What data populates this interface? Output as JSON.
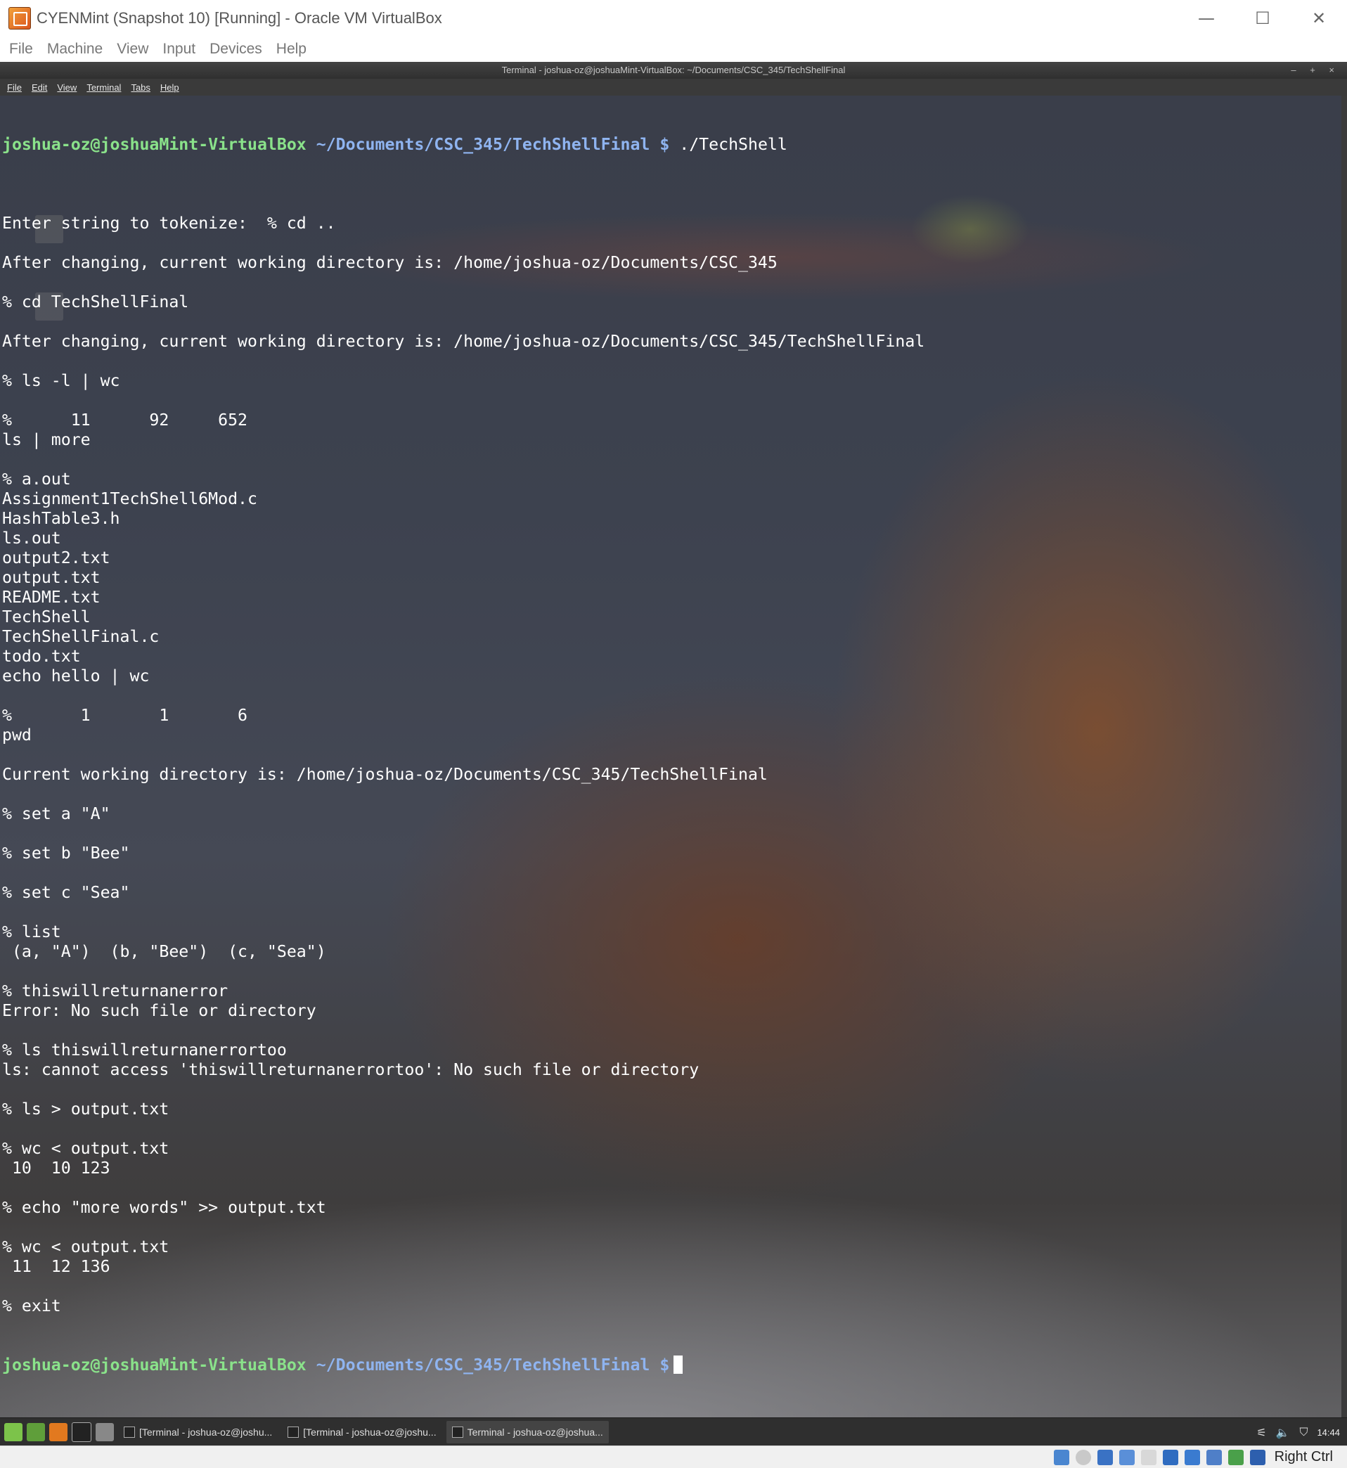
{
  "window": {
    "title": "CYENMint (Snapshot 10) [Running] - Oracle VM VirtualBox",
    "minimize_glyph": "—",
    "maximize_glyph": "☐",
    "close_glyph": "✕"
  },
  "vbox_menu": [
    "File",
    "Machine",
    "View",
    "Input",
    "Devices",
    "Help"
  ],
  "terminal": {
    "title": "Terminal - joshua-oz@joshuaMint-VirtualBox: ~/Documents/CSC_345/TechShellFinal",
    "wm_buttons": "– + ×",
    "menu": [
      "File",
      "Edit",
      "View",
      "Terminal",
      "Tabs",
      "Help"
    ],
    "prompt_user": "joshua-oz@joshuaMint-VirtualBox",
    "prompt_path": "~/Documents/CSC_345/TechShellFinal $",
    "first_command": "./TechShell",
    "lines": [
      "",
      "Enter string to tokenize:  % cd ..",
      "",
      "After changing, current working directory is: /home/joshua-oz/Documents/CSC_345",
      "",
      "% cd TechShellFinal",
      "",
      "After changing, current working directory is: /home/joshua-oz/Documents/CSC_345/TechShellFinal",
      "",
      "% ls -l | wc",
      "",
      "%      11      92     652",
      "ls | more",
      "",
      "% a.out",
      "Assignment1TechShell6Mod.c",
      "HashTable3.h",
      "ls.out",
      "output2.txt",
      "output.txt",
      "README.txt",
      "TechShell",
      "TechShellFinal.c",
      "todo.txt",
      "echo hello | wc",
      "",
      "%       1       1       6",
      "pwd",
      "",
      "Current working directory is: /home/joshua-oz/Documents/CSC_345/TechShellFinal",
      "",
      "% set a \"A\"",
      "",
      "% set b \"Bee\"",
      "",
      "% set c \"Sea\"",
      "",
      "% list",
      " (a, \"A\")  (b, \"Bee\")  (c, \"Sea\")",
      "",
      "% thiswillreturnanerror",
      "Error: No such file or directory",
      "",
      "% ls thiswillreturnanerrortoo",
      "ls: cannot access 'thiswillreturnanerrortoo': No such file or directory",
      "",
      "% ls > output.txt",
      "",
      "% wc < output.txt",
      " 10  10 123",
      "",
      "% echo \"more words\" >> output.txt",
      "",
      "% wc < output.txt",
      " 11  12 136",
      "",
      "% exit"
    ]
  },
  "taskbar": {
    "tasks": [
      "[Terminal - joshua-oz@joshu...",
      "[Terminal - joshua-oz@joshu...",
      "Terminal - joshua-oz@joshua..."
    ],
    "clock": "14:44"
  },
  "statusbar": {
    "host_key": "Right Ctrl"
  },
  "colors": {
    "prompt_user": "#8ae28a",
    "prompt_path": "#8fb4f0",
    "mint_green": "#7cc34a"
  }
}
